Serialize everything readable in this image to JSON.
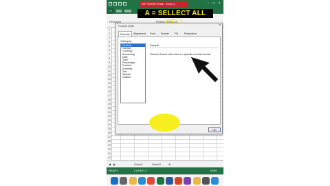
{
  "window": {
    "title": "YDF SHORTSvide - Excel (..."
  },
  "ribbon": {
    "file_tab": "FI",
    "user": "Microsof..."
  },
  "annotation": {
    "text": "A = SELLECT ALL CELL"
  },
  "toolbar": {
    "research": "Research",
    "protect_workbook": "Protect Workbook"
  },
  "dialog": {
    "title": "Format Cells",
    "tabs": [
      "Number",
      "Alignment",
      "Font",
      "Border",
      "Fill",
      "Protection"
    ],
    "category_label": "Category:",
    "categories": [
      "General",
      "Number",
      "Currency",
      "Accounting",
      "Date",
      "Time",
      "Percentage",
      "Fraction",
      "Scientific",
      "Text",
      "Special",
      "Custom"
    ],
    "selected_category": "General",
    "sample_label": "Sample",
    "description": "General format cells have no specific number format.",
    "ok_label": "OK"
  },
  "rows": [
    "1",
    "2",
    "3",
    "4",
    "5",
    "6",
    "7",
    "8",
    "9",
    "10",
    "11",
    "12",
    "13",
    "14",
    "15",
    "16",
    "17",
    "18",
    "19",
    "20",
    "21",
    "22",
    "23",
    "24",
    "25",
    "26",
    "27",
    "28",
    "29",
    "30",
    "31",
    "32"
  ],
  "sheet_tabs": [
    "Sheet2",
    "Sheet3"
  ],
  "status": {
    "ready": "READY",
    "count": "COUNT: 4",
    "zoom": "100%"
  },
  "colors": {
    "excel_green": "#217346",
    "annotation_yellow": "#f7ef1f",
    "title_red": "#c4262e"
  },
  "taskbar_icons": [
    "start-icon",
    "search-icon",
    "file-explorer-icon",
    "edge-icon",
    "chrome-icon",
    "excel-icon",
    "word-icon",
    "powerpoint-icon",
    "media-icon",
    "folder-icon",
    "settings-icon",
    "mail-icon"
  ]
}
